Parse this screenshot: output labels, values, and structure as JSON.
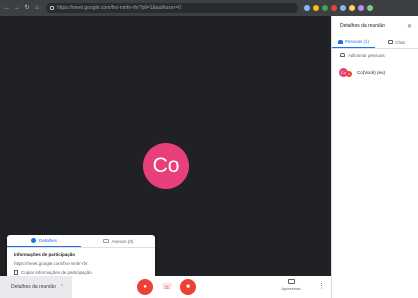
{
  "browser": {
    "url": "https://meet.google.com/fxx-nmhr-rhr?pli=1&authuser=0",
    "nav_icons": [
      "back-icon",
      "forward-icon",
      "reload-icon",
      "home-icon"
    ],
    "extension_colors": [
      "#8ab4f8",
      "#fbbc04",
      "#34a853",
      "#ea4335",
      "#8ab4f8",
      "#fdd663",
      "#c58af9",
      "#81c995"
    ]
  },
  "video": {
    "avatar_initials": "Co",
    "avatar_color": "#e8407a"
  },
  "meeting_popup": {
    "tabs": [
      {
        "label": "Detalhes"
      },
      {
        "label": "Anexos (0)"
      }
    ],
    "title": "Informações de participação",
    "url": "https://meet.google.com/fxx-nmhr-rhr",
    "copy_label": "Copiar informações de participação"
  },
  "bottom_bar": {
    "meeting_details_label": "Detalhes da reunião",
    "present_label": "Apresentar"
  },
  "side_panel": {
    "title": "Detalhes da reunião",
    "tabs": [
      {
        "label": "Pessoas (1)"
      },
      {
        "label": "Chat"
      }
    ],
    "add_people_label": "Adicionar pessoas",
    "participants": [
      {
        "initials": "Co",
        "name": "Co(Você) (eu)"
      }
    ]
  },
  "colors": {
    "accent": "#1a73e8",
    "danger": "#ea4335",
    "avatar": "#e8407a",
    "video_bg": "#202124"
  }
}
